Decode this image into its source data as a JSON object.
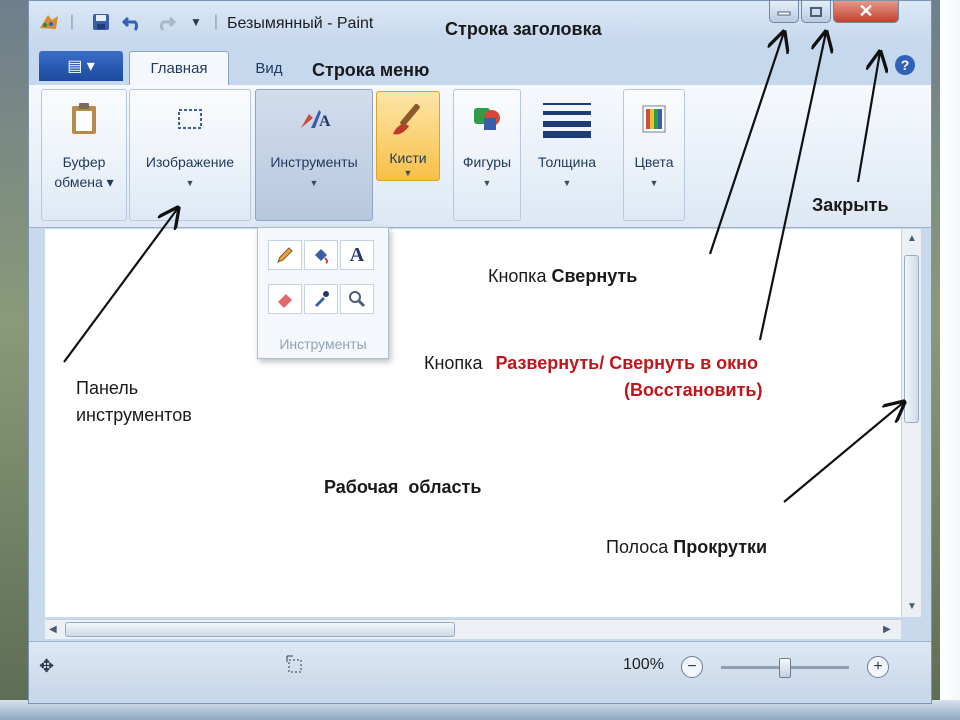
{
  "window": {
    "title": "Безымянный - Paint",
    "quick_access_icons": [
      "paint-app-icon",
      "save-icon",
      "undo-icon",
      "redo-icon",
      "customize-quick-access-icon"
    ]
  },
  "tabs": {
    "file_icon": "file-menu-icon",
    "items": [
      {
        "label": "Главная",
        "active": true
      },
      {
        "label": "Вид",
        "active": false
      }
    ]
  },
  "ribbon": {
    "groups": [
      {
        "label_line1": "Буфер",
        "label_line2": "обмена ▾",
        "icon": "clipboard-icon"
      },
      {
        "label_line1": "Изображение",
        "label_line2": "",
        "icon": "select-icon"
      },
      {
        "label_line1": "Инструменты",
        "label_line2": "",
        "icon": "tools-icon"
      },
      {
        "label_line1": "Кисти",
        "label_line2": "",
        "icon": "brush-icon"
      },
      {
        "label_line1": "Фигуры",
        "label_line2": "",
        "icon": "shapes-icon"
      },
      {
        "label_line1": "Толщина",
        "label_line2": "",
        "icon": "thickness-icon"
      },
      {
        "label_line1": "Цвета",
        "label_line2": "",
        "icon": "colors-icon"
      }
    ]
  },
  "tools_dropdown": {
    "caption": "Инструменты",
    "tools": [
      "pencil-icon",
      "fill-icon",
      "text-icon",
      "eraser-icon",
      "color-picker-icon",
      "magnifier-icon"
    ],
    "text_tool_glyph": "A"
  },
  "statusbar": {
    "zoom": "100%",
    "zoom_level": 1.0
  },
  "annotations": {
    "title_bar": "Строка заголовка",
    "menu_bar": "Строка меню",
    "close": "Закрыть",
    "minimize_prefix": "Кнопка",
    "minimize_bold": "Свернуть",
    "restore_prefix": "Кнопка",
    "restore_red_line1": "Развернуть/ Свернуть в окно",
    "restore_red_line2": "(Восстановить)",
    "toolbar_line1": "Панель",
    "toolbar_line2": "инструментов",
    "workspace": "Рабочая  область",
    "scroll_prefix": "Полоса",
    "scroll_bold": "Прокрутки"
  }
}
